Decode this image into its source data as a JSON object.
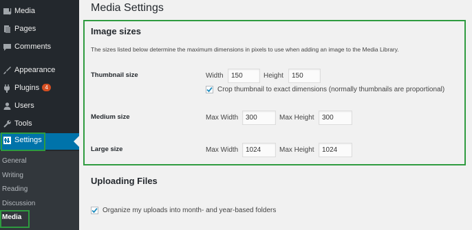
{
  "sidebar": {
    "items": [
      {
        "label": "Media",
        "icon": "media-icon"
      },
      {
        "label": "Pages",
        "icon": "pages-icon"
      },
      {
        "label": "Comments",
        "icon": "comments-icon"
      },
      {
        "label": "Appearance",
        "icon": "appearance-icon"
      },
      {
        "label": "Plugins",
        "icon": "plugins-icon",
        "badge": "4"
      },
      {
        "label": "Users",
        "icon": "users-icon"
      },
      {
        "label": "Tools",
        "icon": "tools-icon"
      },
      {
        "label": "Settings",
        "icon": "settings-icon"
      }
    ],
    "submenu": [
      "General",
      "Writing",
      "Reading",
      "Discussion",
      "Media"
    ]
  },
  "main": {
    "title": "Media Settings",
    "image_sizes": {
      "heading": "Image sizes",
      "description": "The sizes listed below determine the maximum dimensions in pixels to use when adding an image to the Media Library.",
      "thumbnail": {
        "label": "Thumbnail size",
        "width_label": "Width",
        "width_value": "150",
        "height_label": "Height",
        "height_value": "150",
        "crop_label": "Crop thumbnail to exact dimensions (normally thumbnails are proportional)",
        "crop_checked": true
      },
      "medium": {
        "label": "Medium size",
        "max_width_label": "Max Width",
        "max_width_value": "300",
        "max_height_label": "Max Height",
        "max_height_value": "300"
      },
      "large": {
        "label": "Large size",
        "max_width_label": "Max Width",
        "max_width_value": "1024",
        "max_height_label": "Max Height",
        "max_height_value": "1024"
      }
    },
    "uploading": {
      "heading": "Uploading Files",
      "organize_label": "Organize my uploads into month- and year-based folders",
      "organize_checked": true
    }
  },
  "colors": {
    "sidebar_bg": "#23282d",
    "submenu_bg": "#32373c",
    "active": "#0073aa",
    "highlight": "#2e9b3f",
    "badge": "#d54e21"
  }
}
